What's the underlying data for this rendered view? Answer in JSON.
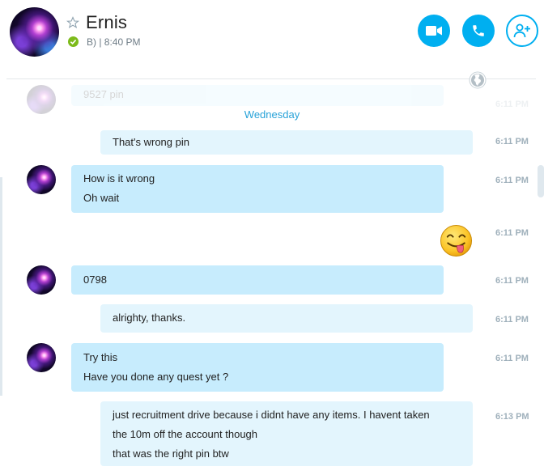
{
  "header": {
    "contact_name": "Ernis",
    "status_text": "B) | 8:40 PM",
    "buttons": [
      {
        "name": "video-call",
        "icon": "video-camera-icon"
      },
      {
        "name": "audio-call",
        "icon": "phone-icon"
      },
      {
        "name": "add-people",
        "icon": "add-person-icon"
      }
    ],
    "accent_color": "#00aff0"
  },
  "conversation": {
    "faded_message": {
      "text": "9527 pin",
      "time": "6:11 PM"
    },
    "day_separator": "Wednesday",
    "messages": [
      {
        "sender": "me",
        "lines": [
          "That's wrong pin"
        ],
        "time": "6:11 PM"
      },
      {
        "sender": "contact",
        "lines": [
          "How is it wrong",
          "Oh wait"
        ],
        "time": "6:11 PM"
      },
      {
        "sender": "me",
        "emoji": "tongue-out-emoji",
        "time": "6:11 PM"
      },
      {
        "sender": "contact",
        "lines": [
          "0798"
        ],
        "time": "6:11 PM"
      },
      {
        "sender": "me",
        "lines": [
          "alrighty, thanks."
        ],
        "time": "6:11 PM"
      },
      {
        "sender": "contact",
        "lines": [
          "Try this",
          "Have you done any quest yet ?"
        ],
        "time": "6:11 PM"
      },
      {
        "sender": "me",
        "lines": [
          "just recruitment drive because i didnt have any items. I havent taken",
          "the 10m off the account though",
          "that was the right pin btw"
        ],
        "time": "6:13 PM"
      }
    ]
  }
}
